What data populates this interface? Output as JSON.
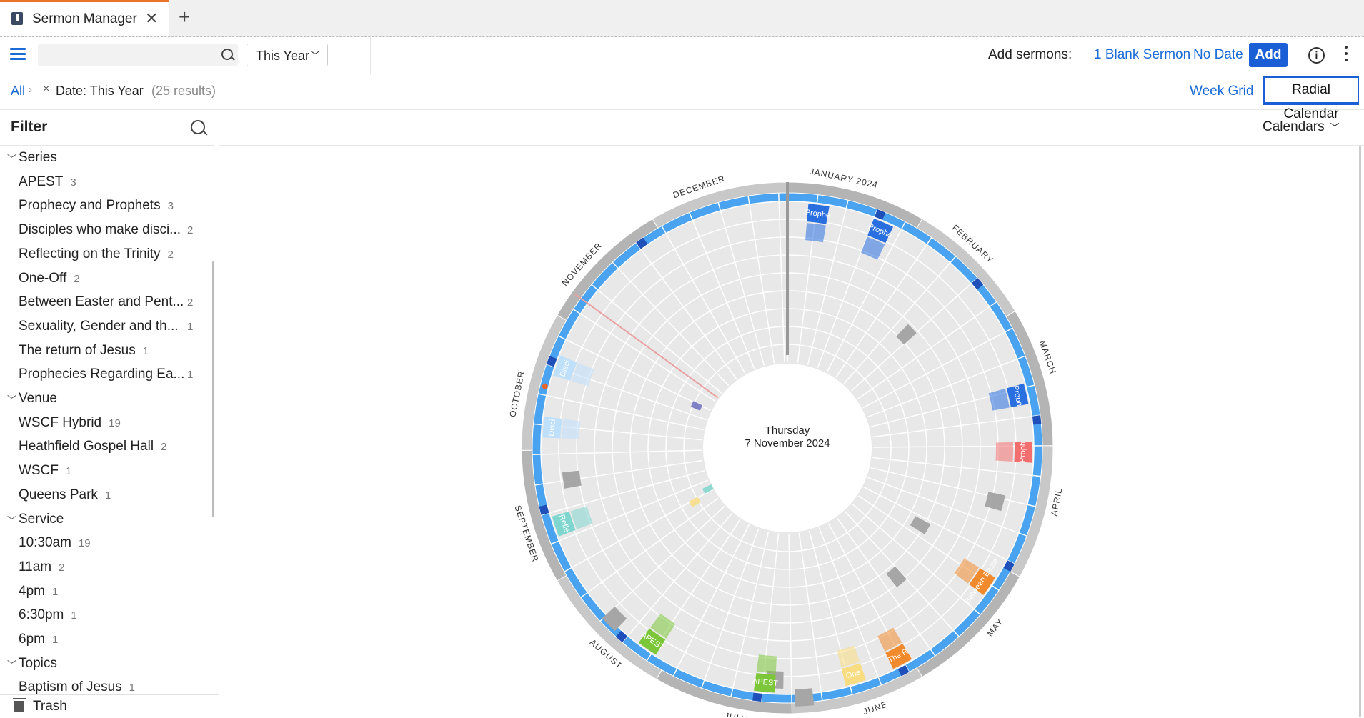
{
  "tab": {
    "title": "Sermon Manager",
    "icon": "sermon-manager-icon",
    "close": "✕",
    "new": "+"
  },
  "toolbar": {
    "search_value": "",
    "range_value": "This Year",
    "add_label": "Add sermons:",
    "blank_link": "1 Blank Sermon",
    "nodate_link": "No Date",
    "add_button": "Add",
    "info": "i"
  },
  "crumbs": {
    "all": "All",
    "sep": "›",
    "remove": "×",
    "filter": "Date: This Year",
    "count": "(25 results)"
  },
  "views": {
    "week": "Week Grid",
    "radial": "Radial Calendar"
  },
  "filter": {
    "title": "Filter",
    "sections": [
      {
        "label": "Series",
        "items": [
          {
            "label": "APEST",
            "count": "3"
          },
          {
            "label": "Prophecy and Prophets",
            "count": "3"
          },
          {
            "label": "Disciples who make disci...",
            "count": "2"
          },
          {
            "label": "Reflecting on the Trinity",
            "count": "2"
          },
          {
            "label": "One-Off",
            "count": "2"
          },
          {
            "label": "Between Easter and Pent...",
            "count": "2"
          },
          {
            "label": "Sexuality, Gender and th...",
            "count": "1"
          },
          {
            "label": "The return of Jesus",
            "count": "1"
          },
          {
            "label": "Prophecies Regarding Ea...",
            "count": "1"
          }
        ]
      },
      {
        "label": "Venue",
        "items": [
          {
            "label": "WSCF Hybrid",
            "count": "19"
          },
          {
            "label": "Heathfield Gospel Hall",
            "count": "2"
          },
          {
            "label": "WSCF",
            "count": "1"
          },
          {
            "label": "Queens Park",
            "count": "1"
          }
        ]
      },
      {
        "label": "Service",
        "items": [
          {
            "label": "10:30am",
            "count": "19"
          },
          {
            "label": "11am",
            "count": "2"
          },
          {
            "label": "4pm",
            "count": "1"
          },
          {
            "label": "6:30pm",
            "count": "1"
          },
          {
            "label": "6pm",
            "count": "1"
          }
        ]
      },
      {
        "label": "Topics",
        "items": [
          {
            "label": "Baptism of Jesus",
            "count": "1"
          }
        ]
      }
    ],
    "trash": "Trash"
  },
  "calendars": {
    "label": "Calendars"
  },
  "radial": {
    "center_day": "Thursday",
    "center_date": "7 November 2024",
    "months": [
      "JANUARY 2024",
      "FEBRUARY",
      "MARCH",
      "APRIL",
      "MAY",
      "JUNE",
      "JULY",
      "AUGUST",
      "SEPTEMBER",
      "OCTOBER",
      "NOVEMBER",
      "DECEMBER"
    ],
    "colors": {
      "ring_blue": "#4aa3f0",
      "ring_dark": "#1f4fb8",
      "grey": "#a6a6a6",
      "prophecy": "#2a6fe0",
      "prophecy_light": "#5aa9ef",
      "disciples": "#bfe0fb",
      "reflecting": "#7fd6cf",
      "apest": "#7cc63a",
      "apest_light": "#b7e07c",
      "one_off": "#f8dc82",
      "easter": "#f08a2c",
      "easter_light": "#f6a860",
      "return": "#f36f6f",
      "sexuality": "#6b6fbf",
      "today": "#e8662a"
    },
    "sermons": [
      {
        "day": 5,
        "label": "Prophe",
        "color": "#2a6fe0"
      },
      {
        "day": 21,
        "label": "Prophe",
        "color": "#2a6fe0"
      },
      {
        "day": 76,
        "label": "Proph",
        "color": "#2a6fe0"
      },
      {
        "day": 90,
        "label": "Proph",
        "color": "#f36f6f"
      },
      {
        "day": 124,
        "label": "Between Easte",
        "color": "#f08a2c"
      },
      {
        "day": 152,
        "label": "The R",
        "color": "#f08a2c"
      },
      {
        "day": 164,
        "label": "One",
        "color": "#f8dc82"
      },
      {
        "day": 186,
        "label": "APEST",
        "color": "#7cc63a"
      },
      {
        "day": 216,
        "label": "APEST",
        "color": "#7cc63a"
      },
      {
        "day": 253,
        "label": "Refle",
        "color": "#7fd6cf"
      },
      {
        "day": 277,
        "label": "Disci",
        "color": "#bfe0fb"
      },
      {
        "day": 292,
        "label": "Disci",
        "color": "#bfe0fb"
      }
    ]
  }
}
